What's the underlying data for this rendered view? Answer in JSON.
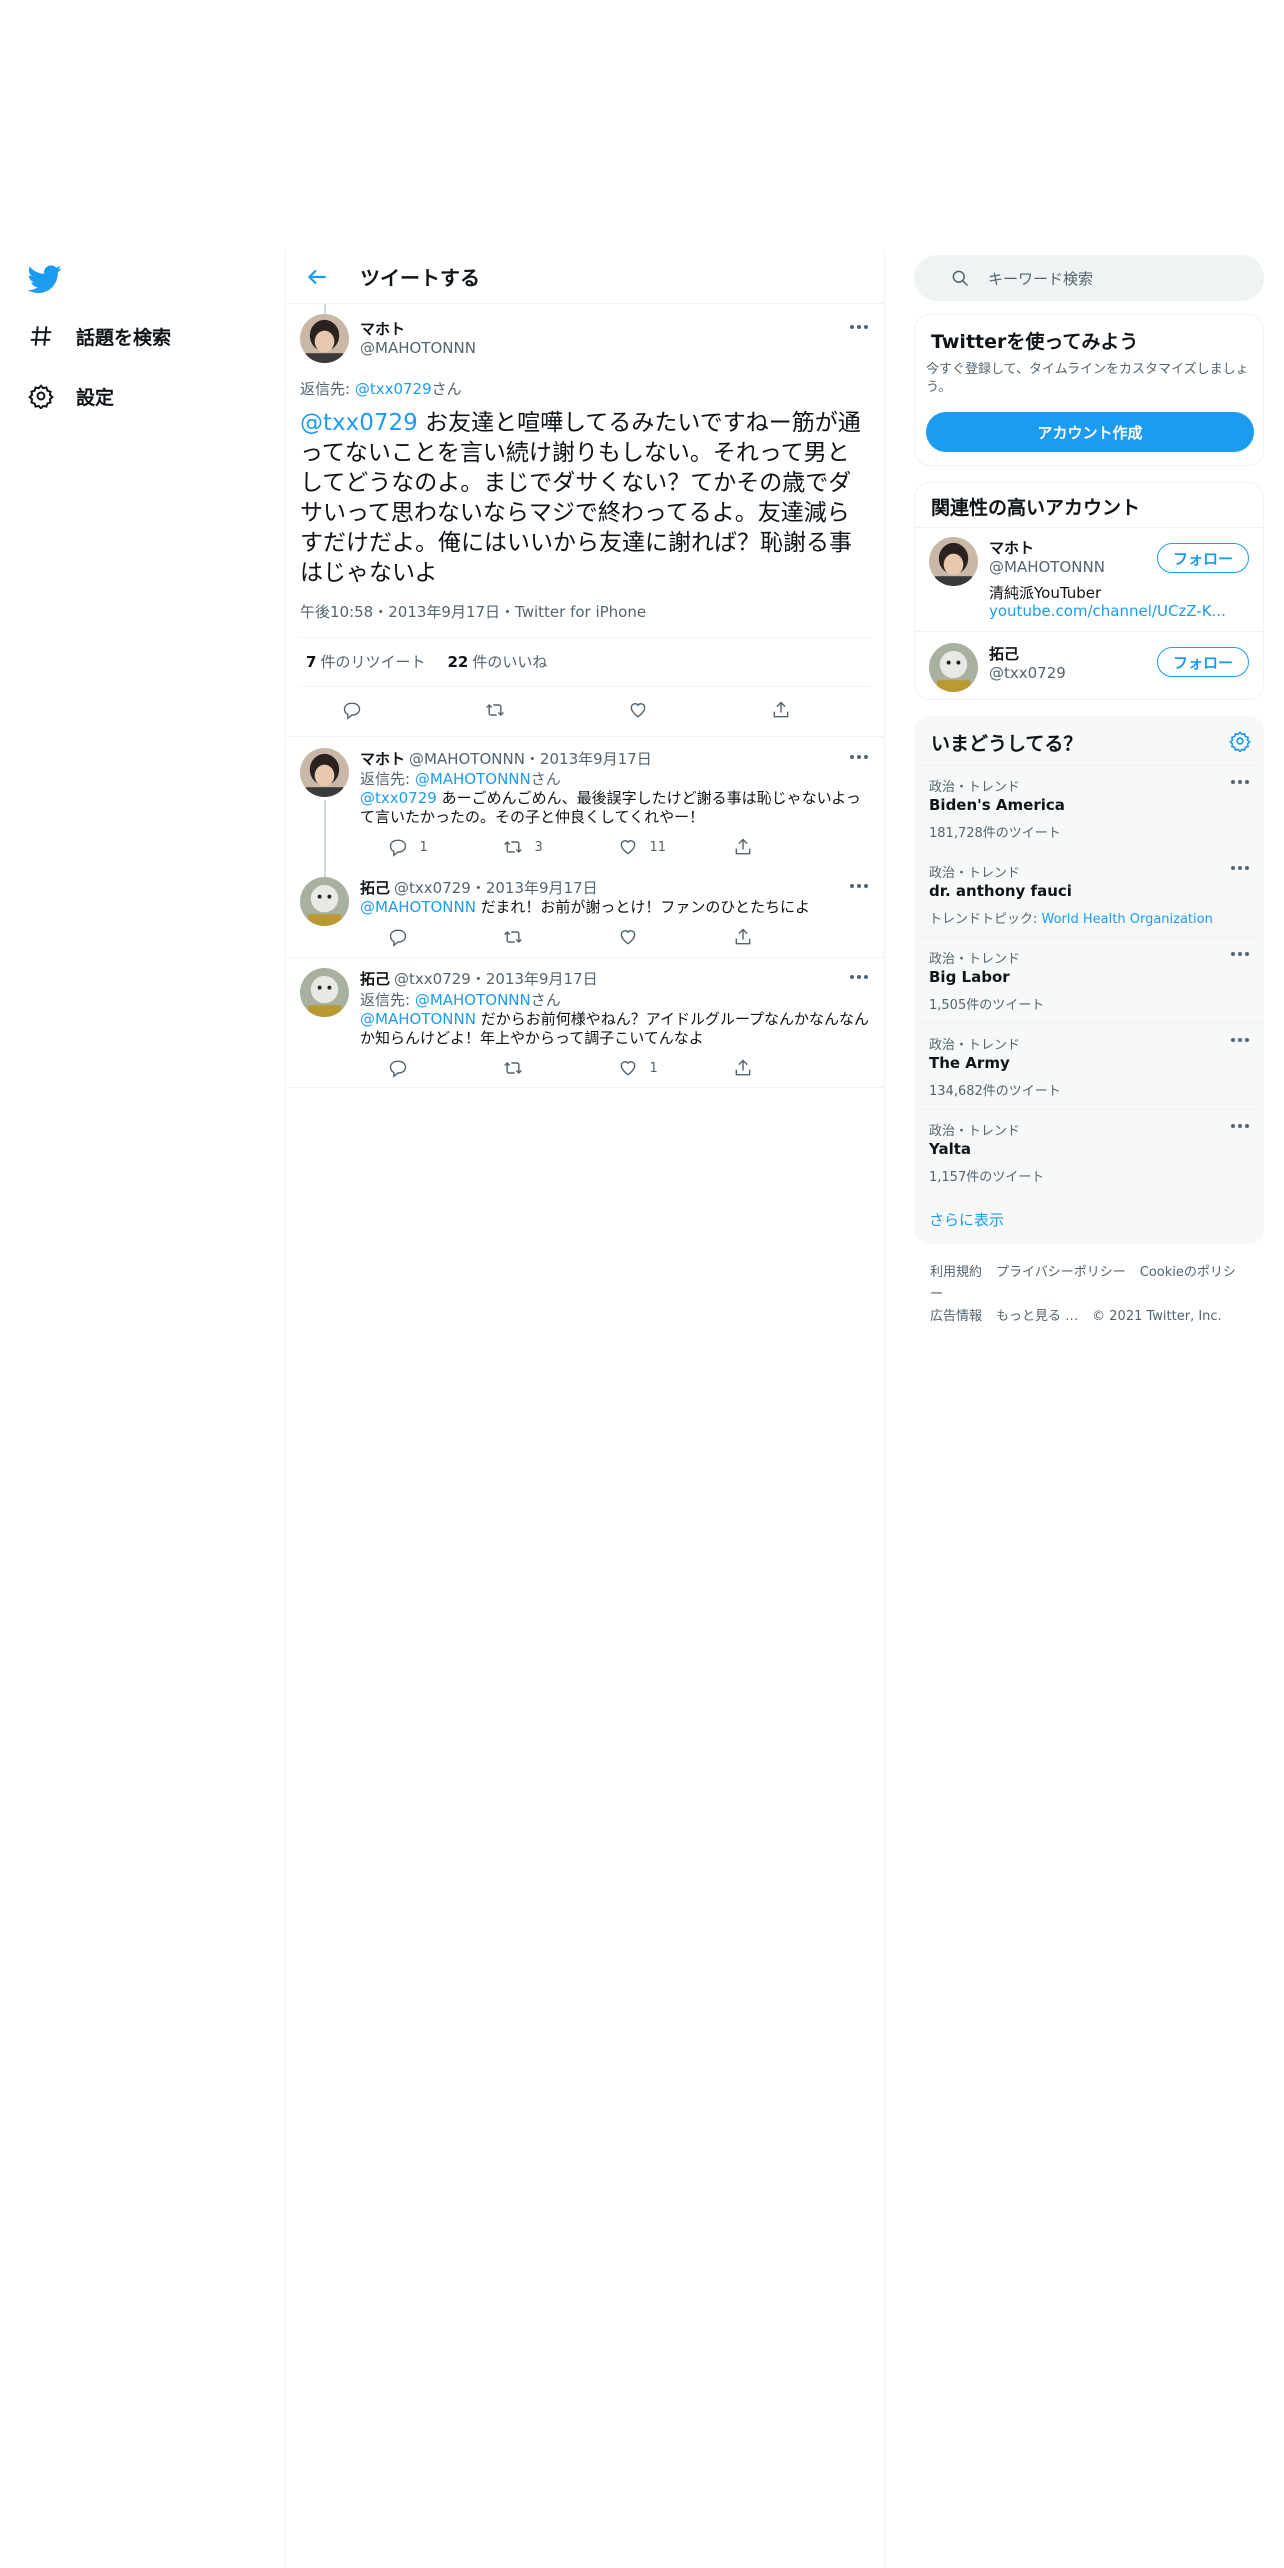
{
  "nav": {
    "explore_label": "話題を検索",
    "settings_label": "設定"
  },
  "header": {
    "title": "ツイートする"
  },
  "main_tweet": {
    "name": "マホト",
    "handle": "@MAHOTONNN",
    "reply_prefix": "返信先: ",
    "reply_to": "@txx0729",
    "reply_suffix": "さん",
    "mention": "@txx0729",
    "text": " お友達と喧嘩してるみたいですねー筋が通ってないことを言い続け謝りもしない。それって男としてどうなのよ。まじでダサくない？てかその歳でダサいって思わないならマジで終わってるよ。友達減らすだけだよ。俺にはいいから友達に謝れば？恥謝る事はじゃないよ",
    "meta": "午後10:58・2013年9月17日・Twitter for iPhone",
    "retweets_count": "7",
    "retweets_label": "件のリツイート",
    "likes_count": "22",
    "likes_label": "件のいいね"
  },
  "replies": [
    {
      "name": "マホト",
      "handle_date": "@MAHOTONNN・2013年9月17日",
      "reply_prefix": "返信先: ",
      "reply_to": "@MAHOTONNN",
      "reply_suffix": "さん",
      "mention": "@txx0729",
      "text": " あーごめんごめん、最後誤字したけど謝る事は恥じゃないよって言いたかったの。その子と仲良くしてくれやー！",
      "replies_count": "1",
      "retweets_count": "3",
      "likes_count": "11"
    },
    {
      "name": "拓己",
      "handle_date": "@txx0729・2013年9月17日",
      "mention": "@MAHOTONNN",
      "text": " だまれ！お前が謝っとけ！ファンのひとたちによ"
    },
    {
      "name": "拓己",
      "handle_date": "@txx0729・2013年9月17日",
      "reply_prefix": "返信先: ",
      "reply_to": "@MAHOTONNN",
      "reply_suffix": "さん",
      "mention": "@MAHOTONNN",
      "text": " だからお前何様やねん？アイドルグループなんかなんなんか知らんけどよ！年上やからって調子こいてんなよ",
      "likes_count": "1"
    }
  ],
  "search": {
    "placeholder": "キーワード検索"
  },
  "signup": {
    "title": "Twitterを使ってみよう",
    "desc": "今すぐ登録して、タイムラインをカスタマイズしましょう。",
    "button": "アカウント作成"
  },
  "related": {
    "title": "関連性の高いアカウント",
    "accounts": [
      {
        "name": "マホト",
        "handle": "@MAHOTONNN",
        "bio": "清純派YouTuber",
        "link": "youtube.com/channel/UCzZ-K...",
        "follow": "フォロー"
      },
      {
        "name": "拓己",
        "handle": "@txx0729",
        "follow": "フォロー"
      }
    ]
  },
  "trends": {
    "title": "いまどうしてる？",
    "items": [
      {
        "category": "政治・トレンド",
        "name": "Biden's America",
        "count": "181,728件のツイート"
      },
      {
        "category": "政治・トレンド",
        "name": "dr. anthony fauci",
        "topic_prefix": "トレンドトピック: ",
        "topic": "World Health Organization"
      },
      {
        "category": "政治・トレンド",
        "name": "Big Labor",
        "count": "1,505件のツイート"
      },
      {
        "category": "政治・トレンド",
        "name": "The Army",
        "count": "134,682件のツイート"
      },
      {
        "category": "政治・トレンド",
        "name": "Yalta",
        "count": "1,157件のツイート"
      }
    ],
    "show_more": "さらに表示"
  },
  "footer": {
    "links": [
      "利用規約",
      "プライバシーポリシー",
      "Cookieのポリシー"
    ],
    "links2": [
      "広告情報",
      "もっと見る …"
    ],
    "copyright": "© 2021 Twitter, Inc."
  },
  "colors": {
    "accent": "#1d9bf0",
    "text": "#0f1419",
    "muted": "#536471",
    "border": "#eff3f4"
  },
  "icons": [
    "twitter-logo-icon",
    "hashtag-icon",
    "gear-icon",
    "back-arrow-icon",
    "more-icon",
    "reply-icon",
    "retweet-icon",
    "like-icon",
    "share-icon",
    "search-icon"
  ]
}
